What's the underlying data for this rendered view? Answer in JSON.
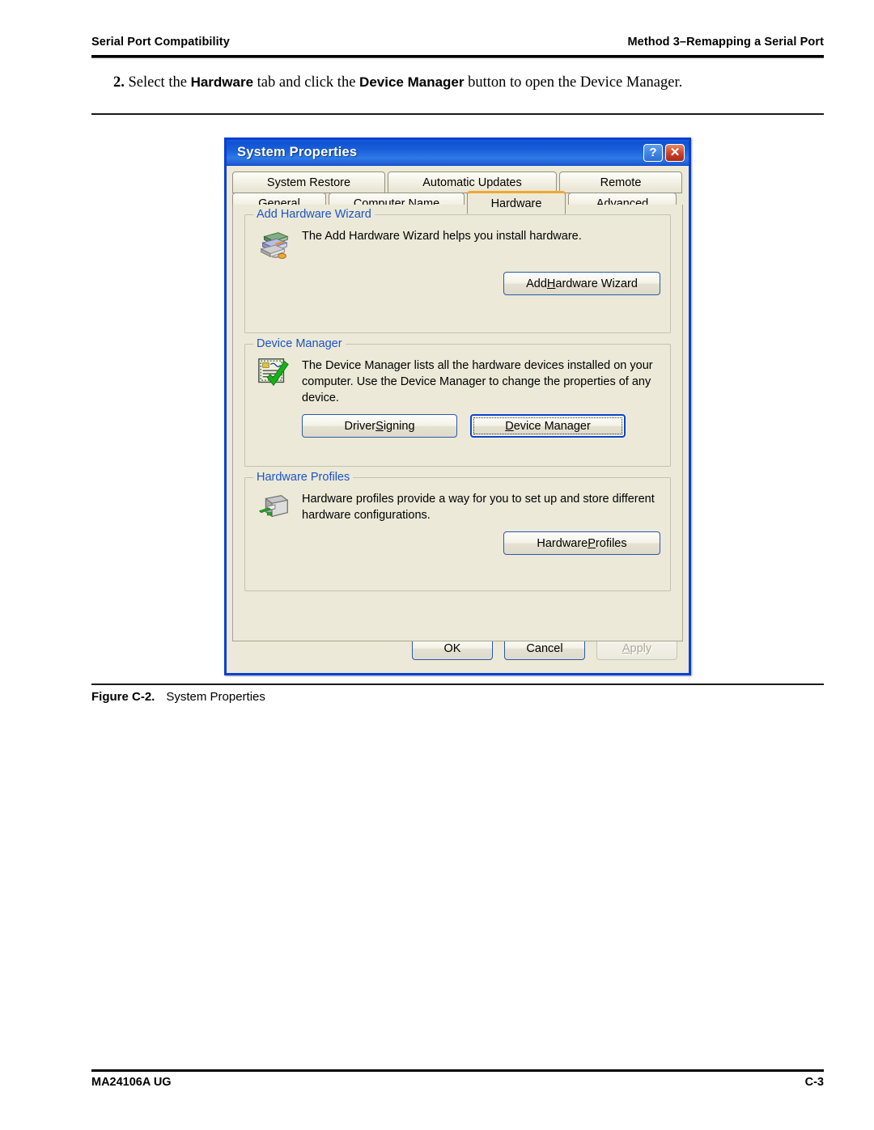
{
  "document": {
    "header_left": "Serial Port Compatibility",
    "header_right": "Method 3–Remapping a Serial Port",
    "step_number": "2.",
    "step_text_1": "Select the ",
    "step_bold_1": "Hardware",
    "step_text_2": " tab and click the ",
    "step_bold_2": "Device Manager",
    "step_text_3": " button to open the Device Manager.",
    "figure_label": "Figure C-2.",
    "figure_title": "System Properties",
    "footer_left": "MA24106A UG",
    "footer_right": "C-3"
  },
  "dialog": {
    "title": "System Properties",
    "help_button": "?",
    "close_button": "✕",
    "tabs_row1": [
      {
        "label": "System Restore",
        "active": false
      },
      {
        "label": "Automatic Updates",
        "active": false
      },
      {
        "label": "Remote",
        "active": false
      }
    ],
    "tabs_row2": [
      {
        "label": "General",
        "active": false
      },
      {
        "label": "Computer Name",
        "active": false
      },
      {
        "label": "Hardware",
        "active": true
      },
      {
        "label": "Advanced",
        "active": false
      }
    ],
    "groups": {
      "add_hardware_wizard": {
        "legend": "Add Hardware Wizard",
        "description": "The Add Hardware Wizard helps you install hardware.",
        "button_pre": "Add ",
        "button_accel": "H",
        "button_post": "ardware Wizard",
        "icon": "add-hardware-icon"
      },
      "device_manager": {
        "legend": "Device Manager",
        "description": "The Device Manager lists all the hardware devices installed on your computer. Use the Device Manager to change the properties of any device.",
        "driver_signing_pre": "Driver ",
        "driver_signing_accel": "S",
        "driver_signing_post": "igning",
        "device_manager_pre": "",
        "device_manager_accel": "D",
        "device_manager_post": "evice Manager",
        "icon": "device-manager-icon"
      },
      "hardware_profiles": {
        "legend": "Hardware Profiles",
        "description": "Hardware profiles provide a way for you to set up and store different hardware configurations.",
        "button_pre": "Hardware ",
        "button_accel": "P",
        "button_post": "rofiles",
        "icon": "hardware-profiles-icon"
      }
    },
    "actions": {
      "ok": "OK",
      "cancel": "Cancel",
      "apply_pre": "",
      "apply_accel": "A",
      "apply_post": "pply",
      "apply_disabled": true
    },
    "colors": {
      "titlebar_blue": "#0f52d3",
      "dialog_face": "#ece9d8",
      "legend_blue": "#1c53c4",
      "active_tab_accent": "#f0a830",
      "button_border": "#2b58a8",
      "close_red": "#c9402a"
    }
  }
}
